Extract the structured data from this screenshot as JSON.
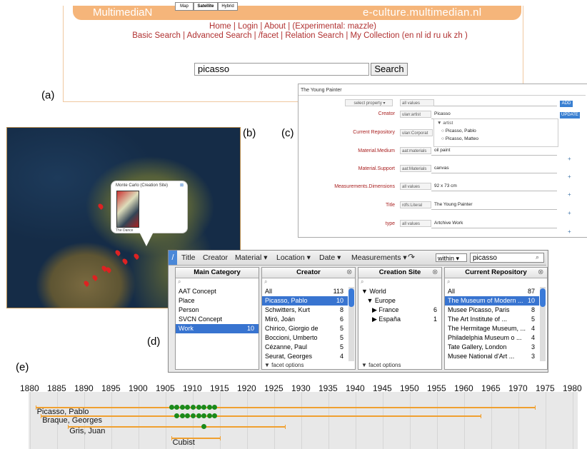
{
  "labels": {
    "a": "(a)",
    "b": "(b)",
    "c": "(c)",
    "d": "(d)",
    "e": "(e)"
  },
  "panel_a": {
    "logo": "MultimediaN",
    "site": "e-culture.multimedian.nl",
    "nav_line1": "Home | Login | About | (Experimental: mazzle)",
    "nav_line2": "Basic Search | Advanced Search | /facet | Relation Search | My Collection (en nl id ru uk zh )",
    "search_value": "picasso",
    "search_button": "Search"
  },
  "panel_b": {
    "map_buttons": [
      "Map",
      "Satellite",
      "Hybrid"
    ],
    "bubble_title": "Monte Carlo (Creation Site)",
    "bubble_caption": "The Dance"
  },
  "panel_c": {
    "title": "The Young Painter",
    "select_property": "select property ▾",
    "add_button": "ADD",
    "update_button": "UPDATE",
    "rows": [
      {
        "prop": "",
        "src": "all values",
        "val": ""
      },
      {
        "prop": "Creator",
        "src": "ulan:artist",
        "val": "Picasso"
      },
      {
        "prop": "Current Repository",
        "src": "ulan:Corporat",
        "val": ""
      },
      {
        "prop": "Material.Medium",
        "src": "aat:materials",
        "val": "oil paint"
      },
      {
        "prop": "Material.Support",
        "src": "aat:Materials",
        "val": "canvas"
      },
      {
        "prop": "Measurements.Dimensions",
        "src": "all values",
        "val": "92 x 73 cm"
      },
      {
        "prop": "Title",
        "src": "rdfs:Literal",
        "val": "The Young Painter"
      },
      {
        "prop": "type",
        "src": "all values",
        "val": "Artchive Work"
      }
    ],
    "suggest_head": "▼ artist",
    "suggest_items": [
      "Picasso, Pablo",
      "Picasso, Matteo"
    ]
  },
  "panel_d": {
    "slash": "/",
    "menus": [
      "Title",
      "Creator",
      "Material ▾",
      "Location ▾",
      "Date ▾",
      "Measurements ▾"
    ],
    "within": "within ▾",
    "query": "picasso",
    "facet_options": "▼ facet options",
    "main_category": {
      "title": "Main Category",
      "rows": [
        {
          "label": "AAT Concept",
          "count": ""
        },
        {
          "label": "Place",
          "count": ""
        },
        {
          "label": "Person",
          "count": ""
        },
        {
          "label": "SVCN Concept",
          "count": ""
        },
        {
          "label": "Work",
          "count": "10"
        }
      ]
    },
    "creator": {
      "title": "Creator",
      "rows": [
        {
          "label": "All",
          "count": "113"
        },
        {
          "label": "Picasso, Pablo",
          "count": "10"
        },
        {
          "label": "Schwitters, Kurt",
          "count": "8"
        },
        {
          "label": "Miró, Joán",
          "count": "6"
        },
        {
          "label": "Chirico, Giorgio de",
          "count": "5"
        },
        {
          "label": "Boccioni, Umberto",
          "count": "5"
        },
        {
          "label": "Cézanne, Paul",
          "count": "5"
        },
        {
          "label": "Seurat, Georges",
          "count": "4"
        }
      ]
    },
    "creation_site": {
      "title": "Creation Site",
      "rows": [
        {
          "label": "▼ World",
          "count": ""
        },
        {
          "label": "   ▼ Europe",
          "count": ""
        },
        {
          "label": "      ▶ France",
          "count": "6"
        },
        {
          "label": "      ▶ España",
          "count": "1"
        }
      ]
    },
    "current_repository": {
      "title": "Current Repository",
      "rows": [
        {
          "label": "All",
          "count": "87"
        },
        {
          "label": "The Museum of Modern ...",
          "count": "10"
        },
        {
          "label": "Musee Picasso, Paris",
          "count": "8"
        },
        {
          "label": "The Art Institute of ...",
          "count": "5"
        },
        {
          "label": "The Hermitage Museum, ...",
          "count": "4"
        },
        {
          "label": "Philadelphia Museum o ...",
          "count": "4"
        },
        {
          "label": "Tate Gallery, London",
          "count": "3"
        },
        {
          "label": "Musee National d'Art ...",
          "count": "3"
        }
      ]
    }
  },
  "panel_e": {
    "years": [
      "1880",
      "1885",
      "1890",
      "1895",
      "1900",
      "1905",
      "1910",
      "1915",
      "1920",
      "1925",
      "1930",
      "1935",
      "1940",
      "1945",
      "1950",
      "1955",
      "1960",
      "1965",
      "1970",
      "1975",
      "1980"
    ],
    "lanes": [
      {
        "label": "Picasso, Pablo",
        "start": 1881,
        "end": 1973,
        "dots": [
          1906,
          1907,
          1908,
          1909,
          1910,
          1911,
          1912,
          1913,
          1914
        ]
      },
      {
        "label": "Braque, Georges",
        "start": 1882,
        "end": 1963,
        "dots": [
          1907,
          1908,
          1909,
          1910,
          1911,
          1912,
          1913,
          1914
        ]
      },
      {
        "label": "Gris, Juan",
        "start": 1887,
        "end": 1927,
        "dots": [
          1912
        ]
      },
      {
        "label": "Cubist",
        "start": 1906,
        "end": 1915,
        "dots": []
      }
    ]
  }
}
